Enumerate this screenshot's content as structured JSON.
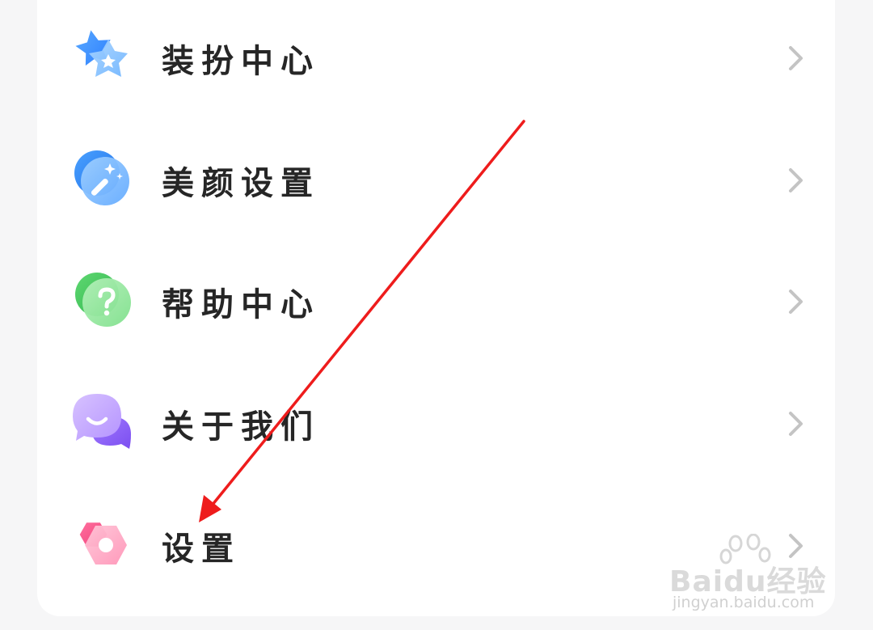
{
  "menu": {
    "items": [
      {
        "label": "装扮中心",
        "icon": "dress-up-star-icon"
      },
      {
        "label": "美颜设置",
        "icon": "beauty-magic-wand-icon"
      },
      {
        "label": "帮助中心",
        "icon": "help-question-icon"
      },
      {
        "label": "关于我们",
        "icon": "about-chat-bubble-icon"
      },
      {
        "label": "设置",
        "icon": "settings-gear-icon"
      }
    ]
  },
  "watermark": {
    "brand": "Baidu经验",
    "site": "jingyan.baidu.com"
  },
  "colors": {
    "page_background": "#f6f6f7",
    "card_background": "#ffffff",
    "chevron": "#c4c4c4",
    "annotation_arrow": "#ee1c1c"
  }
}
